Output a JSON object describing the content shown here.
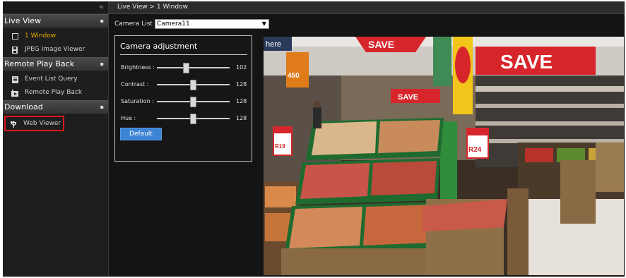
{
  "sidebar": {
    "collapse_glyph": "«",
    "sections": [
      {
        "label": "Live View",
        "arrow": "▪",
        "items": [
          {
            "label": "1 Window",
            "icon": "window-icon",
            "active": true
          },
          {
            "label": "JPEG Image Viewer",
            "icon": "film-icon"
          }
        ]
      },
      {
        "label": "Remote Play Back",
        "arrow": "▪",
        "items": [
          {
            "label": "Event List Query",
            "icon": "document-icon"
          },
          {
            "label": "Remote Play Back",
            "icon": "playback-icon"
          }
        ]
      },
      {
        "label": "Download",
        "arrow": "▪",
        "items": [
          {
            "label": "Web Viewer",
            "icon": "usb-icon",
            "highlight": true
          }
        ]
      }
    ]
  },
  "header": {
    "breadcrumb": "Live View > 1 Window"
  },
  "camera": {
    "list_label": "Camera List",
    "selected": "Camera11"
  },
  "adjustment": {
    "title": "Camera adjustment",
    "sliders": [
      {
        "label": "Brightness :",
        "value": "102",
        "level": 0.4
      },
      {
        "label": "Contrast :",
        "value": "128",
        "level": 0.5
      },
      {
        "label": "Saturation :",
        "value": "128",
        "level": 0.5
      },
      {
        "label": "Hue :",
        "value": "128",
        "level": 0.5
      }
    ],
    "default_label": "Default"
  },
  "video": {
    "signs": {
      "save_top": "SAVE",
      "save_big": "SAVE",
      "save_mid": "SAVE",
      "price1": "R24",
      "price2": "R19",
      "here": "here",
      "price_top": "450"
    }
  },
  "colors": {
    "accent": "#e6a900",
    "highlight_box": "#e0151b",
    "button": "#3d84d6"
  }
}
